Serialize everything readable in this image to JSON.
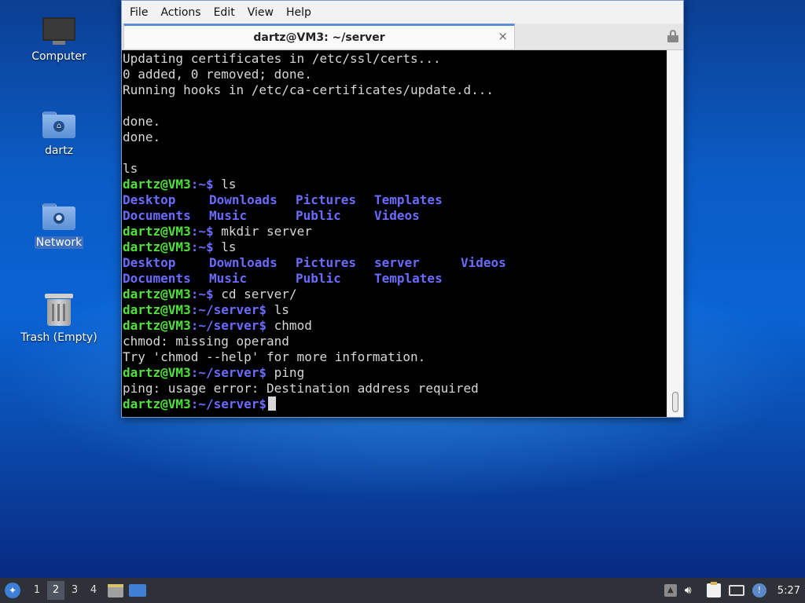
{
  "desktop": {
    "icons": [
      {
        "label": "Computer"
      },
      {
        "label": "dartz"
      },
      {
        "label": "Network"
      },
      {
        "label": "Trash (Empty)"
      }
    ]
  },
  "window": {
    "menus": [
      "File",
      "Actions",
      "Edit",
      "View",
      "Help"
    ],
    "tab_title": "dartz@VM3: ~/server",
    "close_glyph": "×"
  },
  "terminal": {
    "prompt_user": "dartz@VM3",
    "lines": {
      "l1": "Updating certificates in /etc/ssl/certs...",
      "l2": "0 added, 0 removed; done.",
      "l3": "Running hooks in /etc/ca-certificates/update.d...",
      "l4": "done.",
      "l5": "done.",
      "l6": "ls",
      "cmd1": " ls",
      "cmd2": " mkdir server",
      "cmd3": " ls",
      "cmd4": " cd server/",
      "cmd5": " ls",
      "cmd6": " chmod",
      "out1": "chmod: missing operand",
      "out2": "Try 'chmod --help' for more information.",
      "cmd7": " ping",
      "out3": "ping: usage error: Destination address required"
    },
    "home_suffix": ":~$",
    "server_suffix": ":~/server$",
    "ls1": {
      "row1": [
        "Desktop",
        "Downloads",
        "Pictures",
        "Templates"
      ],
      "row2": [
        "Documents",
        "Music",
        "Public",
        "Videos"
      ]
    },
    "ls2": {
      "row1": [
        "Desktop",
        "Downloads",
        "Pictures",
        "server",
        "Videos"
      ],
      "row2": [
        "Documents",
        "Music",
        "Public",
        "Templates"
      ]
    }
  },
  "taskbar": {
    "menu_icon": "whisker-menu-icon",
    "workspaces": [
      "1",
      "2",
      "3",
      "4"
    ],
    "active_workspace": "2",
    "clock": "5:27"
  }
}
